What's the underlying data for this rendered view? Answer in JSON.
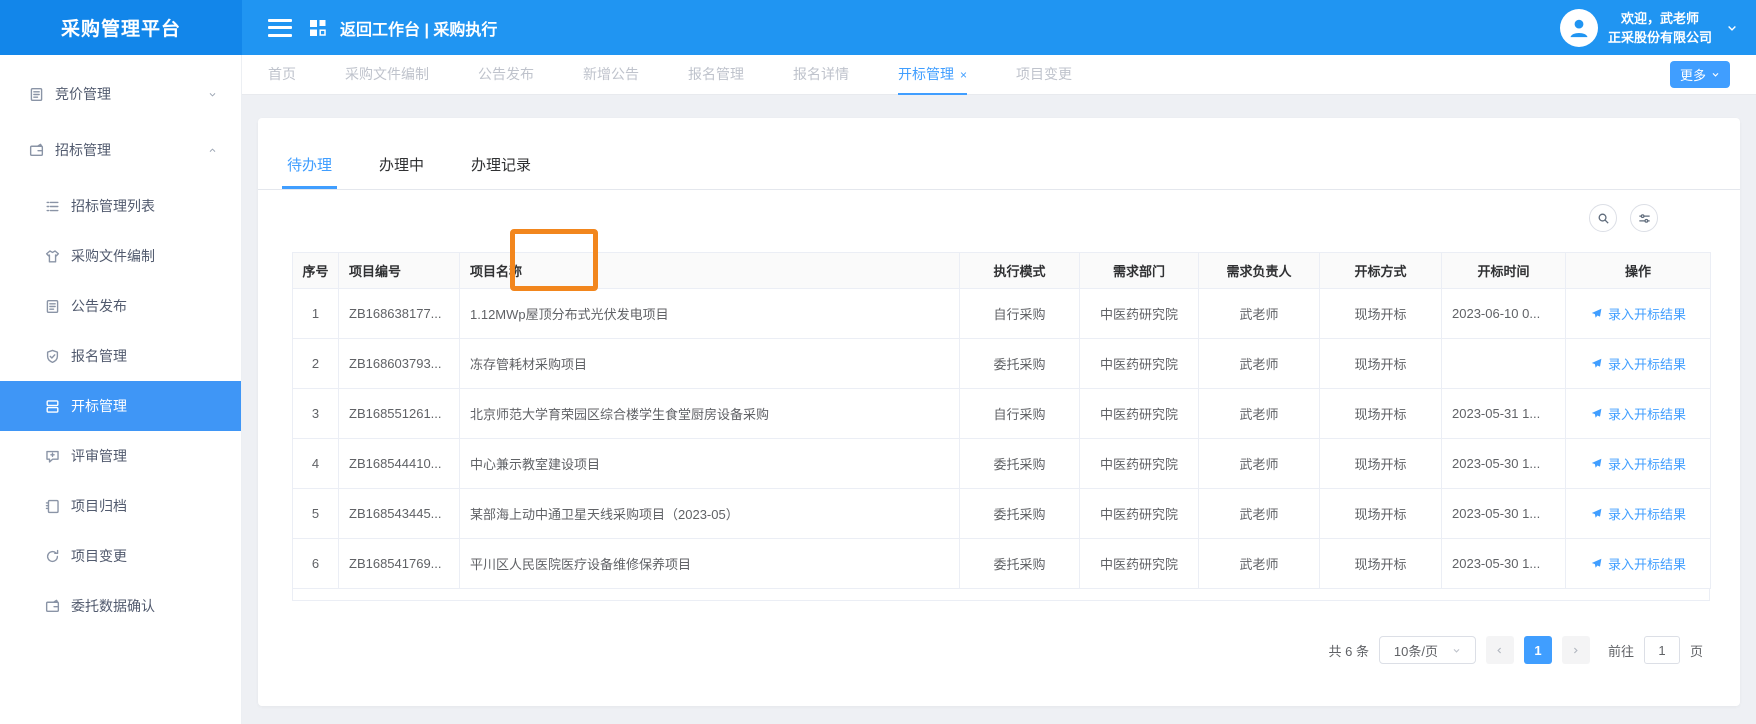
{
  "colors": {
    "topbar": "#2095f2",
    "logo_bg": "#1286ea",
    "primary": "#409eff",
    "annotation": "#f2861d",
    "sidebar_active_bg": "#3f96f6"
  },
  "topbar": {
    "logo": "采购管理平台",
    "breadcrumb": "返回工作台 | 采购执行",
    "welcome": "欢迎，武老师",
    "company": "正采股份有限公司"
  },
  "sidebar": {
    "items": [
      {
        "label": "竞价管理",
        "icon": "clipboard-icon",
        "level": 1,
        "chevron": "down",
        "active": false
      },
      {
        "label": "招标管理",
        "icon": "wallet-icon",
        "level": 1,
        "chevron": "up",
        "active": false
      },
      {
        "label": "招标管理列表",
        "icon": "list-icon",
        "level": 2,
        "active": false
      },
      {
        "label": "采购文件编制",
        "icon": "shirt-icon",
        "level": 2,
        "active": false
      },
      {
        "label": "公告发布",
        "icon": "clipboard-icon",
        "level": 2,
        "active": false
      },
      {
        "label": "报名管理",
        "icon": "shield-check-icon",
        "level": 2,
        "active": false
      },
      {
        "label": "开标管理",
        "icon": "panels-icon",
        "level": 2,
        "active": true
      },
      {
        "label": "评审管理",
        "icon": "chat-plus-icon",
        "level": 2,
        "active": false
      },
      {
        "label": "项目归档",
        "icon": "book-icon",
        "level": 2,
        "active": false
      },
      {
        "label": "项目变更",
        "icon": "refresh-icon",
        "level": 2,
        "active": false
      },
      {
        "label": "委托数据确认",
        "icon": "wallet-icon",
        "level": 2,
        "active": false
      }
    ]
  },
  "tabs": {
    "items": [
      {
        "label": "首页",
        "active": false,
        "closable": false
      },
      {
        "label": "采购文件编制",
        "active": false,
        "closable": false
      },
      {
        "label": "公告发布",
        "active": false,
        "closable": false
      },
      {
        "label": "新增公告",
        "active": false,
        "closable": false
      },
      {
        "label": "报名管理",
        "active": false,
        "closable": false
      },
      {
        "label": "报名详情",
        "active": false,
        "closable": false
      },
      {
        "label": "开标管理",
        "active": true,
        "closable": true
      },
      {
        "label": "项目变更",
        "active": false,
        "closable": false
      }
    ],
    "more_label": "更多"
  },
  "panel": {
    "subtabs": [
      {
        "label": "待办理",
        "active": true
      },
      {
        "label": "办理中",
        "active": false
      },
      {
        "label": "办理记录",
        "active": false
      }
    ],
    "table": {
      "headers": [
        "序号",
        "项目编号",
        "项目名称",
        "执行模式",
        "需求部门",
        "需求负责人",
        "开标方式",
        "开标时间",
        "操作"
      ],
      "action_label": "录入开标结果",
      "rows": [
        {
          "index": "1",
          "code": "ZB168638177...",
          "name": "1.12MWp屋顶分布式光伏发电项目",
          "mode": "自行采购",
          "dept": "中医药研究院",
          "owner": "武老师",
          "method": "现场开标",
          "time": "2023-06-10 0..."
        },
        {
          "index": "2",
          "code": "ZB168603793...",
          "name": "冻存管耗材采购项目",
          "mode": "委托采购",
          "dept": "中医药研究院",
          "owner": "武老师",
          "method": "现场开标",
          "time": ""
        },
        {
          "index": "3",
          "code": "ZB168551261...",
          "name": "北京师范大学育荣园区综合楼学生食堂厨房设备采购",
          "mode": "自行采购",
          "dept": "中医药研究院",
          "owner": "武老师",
          "method": "现场开标",
          "time": "2023-05-31 1..."
        },
        {
          "index": "4",
          "code": "ZB168544410...",
          "name": "中心兼示教室建设项目",
          "mode": "委托采购",
          "dept": "中医药研究院",
          "owner": "武老师",
          "method": "现场开标",
          "time": "2023-05-30 1..."
        },
        {
          "index": "5",
          "code": "ZB168543445...",
          "name": "某部海上动中通卫星天线采购项目（2023-05）",
          "mode": "委托采购",
          "dept": "中医药研究院",
          "owner": "武老师",
          "method": "现场开标",
          "time": "2023-05-30 1..."
        },
        {
          "index": "6",
          "code": "ZB168541769...",
          "name": "平川区人民医院医疗设备维修保养项目",
          "mode": "委托采购",
          "dept": "中医药研究院",
          "owner": "武老师",
          "method": "现场开标",
          "time": "2023-05-30 1..."
        }
      ]
    },
    "pagination": {
      "total": "共 6 条",
      "page_size": "10条/页",
      "current_page": "1",
      "goto_label": "前往",
      "goto_value": "1",
      "page_suffix": "页"
    }
  }
}
